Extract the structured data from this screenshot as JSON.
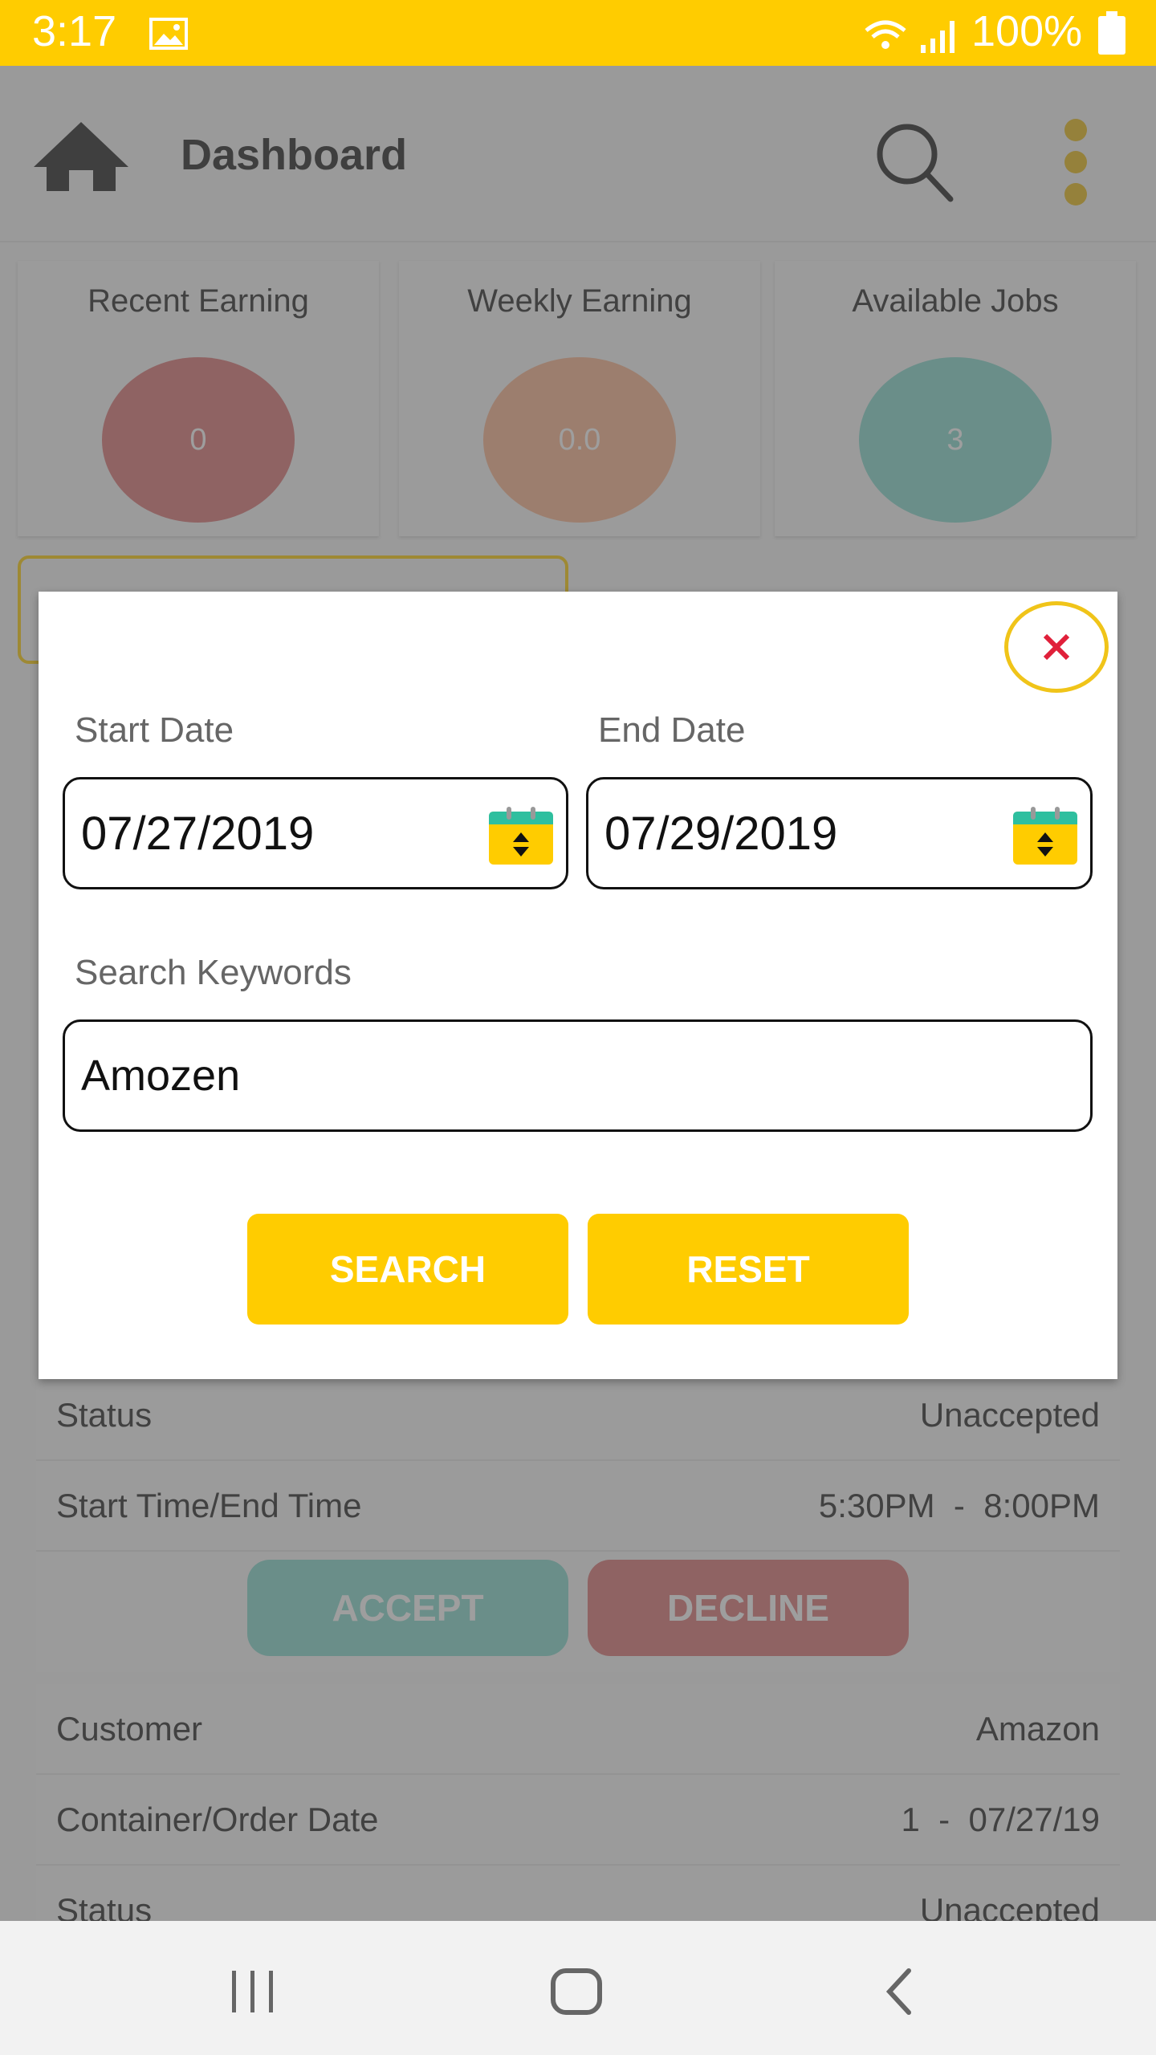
{
  "status_bar": {
    "time": "3:17",
    "battery": "100%",
    "icons": [
      "image-icon",
      "wifi-icon",
      "signal-icon",
      "battery-icon"
    ]
  },
  "app_bar": {
    "title": "Dashboard",
    "icons": [
      "home-icon",
      "search-icon",
      "more-vert-icon"
    ]
  },
  "stats": [
    {
      "label": "Recent Earning",
      "value": "0",
      "color": "#e7a1a1"
    },
    {
      "label": "Weekly Earning",
      "value": "0.0",
      "color": "#fcccb2"
    },
    {
      "label": "Available Jobs",
      "value": "3",
      "color": "#ace5dd"
    }
  ],
  "jobs": [
    {
      "rows": [
        {
          "label": "Status",
          "value": "Unaccepted"
        },
        {
          "label": "Start Time/End Time",
          "value": "5:30PM  -  8:00PM"
        }
      ],
      "accept": "ACCEPT",
      "decline": "DECLINE"
    },
    {
      "rows": [
        {
          "label": "Customer",
          "value": "Amazon"
        },
        {
          "label": "Container/Order Date",
          "value": "1  -  07/27/19"
        },
        {
          "label": "Status",
          "value": "Unaccepted"
        }
      ]
    }
  ],
  "dialog": {
    "start_date_label": "Start Date",
    "start_date": "07/27/2019",
    "end_date_label": "End Date",
    "end_date": "07/29/2019",
    "keywords_label": "Search Keywords",
    "keywords": "Amozen",
    "search": "SEARCH",
    "reset": "RESET"
  },
  "colors": {
    "accent": "#ffcc00",
    "close": "#e0203a",
    "accept": "#ace5dd",
    "decline": "#e7a1a1"
  }
}
